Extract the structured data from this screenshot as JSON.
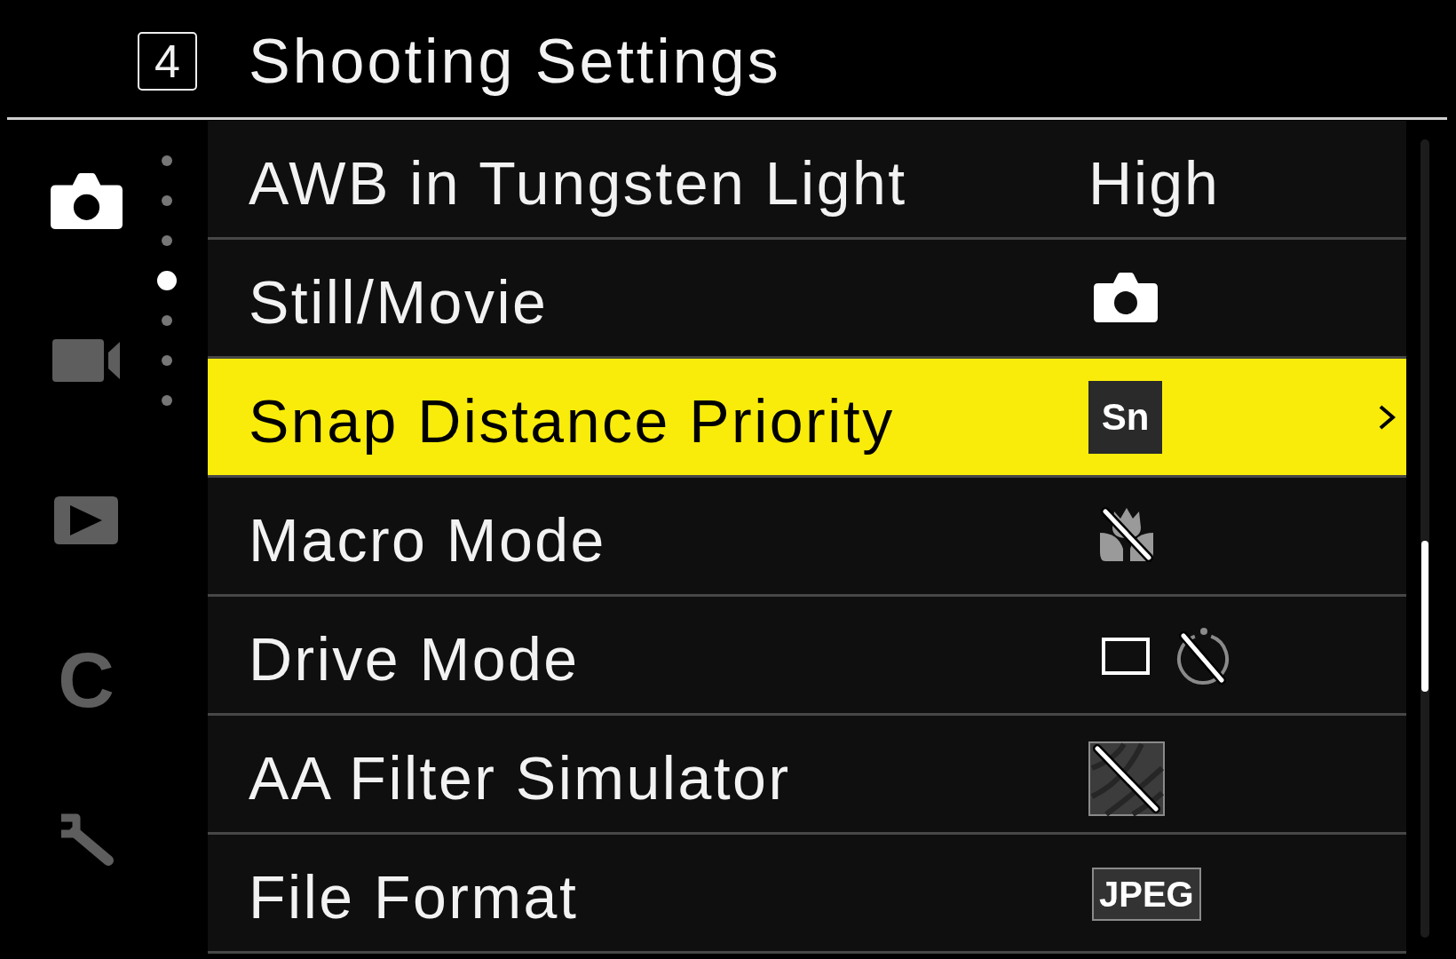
{
  "header": {
    "page_number": "4",
    "title": "Shooting Settings"
  },
  "sidebar": {
    "tabs": [
      {
        "kind": "camera",
        "selected": true
      },
      {
        "kind": "video",
        "selected": false
      },
      {
        "kind": "playback",
        "selected": false
      },
      {
        "kind": "letter",
        "text": "C",
        "selected": false
      },
      {
        "kind": "wrench",
        "selected": false
      }
    ],
    "pages": [
      {
        "selected": false
      },
      {
        "selected": false
      },
      {
        "selected": false
      },
      {
        "selected": true
      },
      {
        "selected": false
      },
      {
        "selected": false
      },
      {
        "selected": false
      }
    ]
  },
  "menu": {
    "items": [
      {
        "label": "AWB in Tungsten Light",
        "value": {
          "kind": "text",
          "text": "High"
        },
        "selected": false,
        "submenu": false
      },
      {
        "label": "Still/Movie",
        "value": {
          "kind": "camera"
        },
        "selected": false,
        "submenu": false
      },
      {
        "label": "Snap Distance Priority",
        "value": {
          "kind": "badge",
          "text": "Sn"
        },
        "selected": true,
        "submenu": true
      },
      {
        "label": "Macro Mode",
        "value": {
          "kind": "flower_off"
        },
        "selected": false,
        "submenu": false
      },
      {
        "label": "Drive Mode",
        "value": {
          "kind": "single_frame_timer_off"
        },
        "selected": false,
        "submenu": false
      },
      {
        "label": "AA Filter Simulator",
        "value": {
          "kind": "pattern_off"
        },
        "selected": false,
        "submenu": false
      },
      {
        "label": "File Format",
        "value": {
          "kind": "framed_badge",
          "text": "JPEG"
        },
        "selected": false,
        "submenu": false
      }
    ]
  }
}
